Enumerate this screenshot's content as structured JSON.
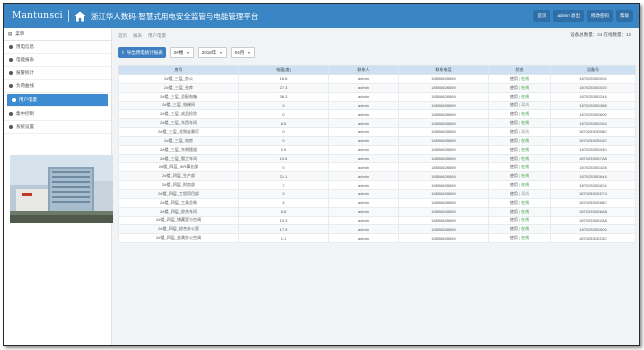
{
  "header": {
    "brand": "Mantunsci",
    "title": "浙江华人数码·智慧式用电安全监管与电能管理平台",
    "buttons": [
      "首页",
      "admin 退出",
      "修改密码",
      "帮助"
    ]
  },
  "sidebar": {
    "title": "菜单",
    "items": [
      {
        "label": "用电信息",
        "active": false
      },
      {
        "label": "电能报表",
        "active": false
      },
      {
        "label": "报警统计",
        "active": false
      },
      {
        "label": "负荷曲线",
        "active": false
      },
      {
        "label": "用户电量",
        "active": true
      },
      {
        "label": "集中控制",
        "active": false
      },
      {
        "label": "系统设置",
        "active": false
      }
    ]
  },
  "breadcrumb": [
    "首页",
    "报表",
    "用户电量"
  ],
  "stats": "设备总数量：24  在线数量：12",
  "toolbar": {
    "action": "导出用电统计报表",
    "filters": [
      "2#楼",
      "2018年",
      "04月"
    ]
  },
  "table": {
    "columns": [
      "房号",
      "电量(度)",
      "联系人",
      "联系电话",
      "状态",
      "设备号"
    ],
    "rows": [
      [
        "2#楼_三层_办公",
        "16.8",
        "admin",
        "18506826569",
        "使用|在线",
        "18702530D004"
      ],
      [
        "2#楼_三层_仓库",
        "27.3",
        "admin",
        "18506826569",
        "使用|在线",
        "18702530D020"
      ],
      [
        "2#楼_三层_总配电箱",
        "38.3",
        "admin",
        "18506826569",
        "使用|在线",
        "18702530D244"
      ],
      [
        "2#楼_三层_电梯间",
        "0",
        "admin",
        "18506826569",
        "使用|离线",
        "18702530D388"
      ],
      [
        "2#楼_三层_成品检验",
        "0",
        "admin",
        "18506826569",
        "使用|在线",
        "18702530D600"
      ],
      [
        "2#楼_三层_东西车间",
        "8.5",
        "admin",
        "18506826569",
        "使用|在线",
        "18702530D264"
      ],
      [
        "2#楼_三层_北侧走廊灯",
        "0",
        "admin",
        "18506826569",
        "使用|离线",
        "18702530D08C"
      ],
      [
        "2#楼_三层_电房",
        "0",
        "admin",
        "18506826569",
        "使用|在线",
        "18702530D04C"
      ],
      [
        "2#楼_三层_东侧楼道",
        "2.9",
        "admin",
        "18506826569",
        "使用|在线",
        "18702530D040"
      ],
      [
        "2#楼_三层_镀工车间",
        "10.6",
        "admin",
        "18506826569",
        "使用|在线",
        "18702530D7A8"
      ],
      [
        "2#楼_四层_IKR事业部",
        "0",
        "admin",
        "18506826569",
        "使用|在线",
        "18702530D428"
      ],
      [
        "2#楼_四层_生产部",
        "21.1",
        "admin",
        "18506826569",
        "使用|在线",
        "18702530D644"
      ],
      [
        "2#楼_四层_财务部",
        "7",
        "admin",
        "18506826569",
        "使用|在线",
        "18702530D624"
      ],
      [
        "2#楼_四层_工程项目部",
        "0",
        "admin",
        "18506826569",
        "使用|离线",
        "18702530DD74"
      ],
      [
        "2#楼_四层_工具总装",
        "4",
        "admin",
        "18506826569",
        "使用|在线",
        "18702530D68C"
      ],
      [
        "2#楼_四层_综合车间",
        "6.8",
        "admin",
        "18506826569",
        "使用|在线",
        "18702530D6A8"
      ],
      [
        "2#楼_四层_储藏室与空调",
        "10.3",
        "admin",
        "18506826569",
        "使用|在线",
        "18702530D2A8"
      ],
      [
        "2#楼_四层_综合办公室",
        "17.9",
        "admin",
        "18506826569",
        "使用|在线",
        "18702530D500"
      ],
      [
        "2#楼_四层_金属办公空调",
        "1.1",
        "admin",
        "18506826569",
        "使用|在线",
        "18702530D23C"
      ]
    ]
  },
  "colors": {
    "topbar": "#3a86c4",
    "accent": "#3d8bd0",
    "online": "#2c9c3a"
  }
}
